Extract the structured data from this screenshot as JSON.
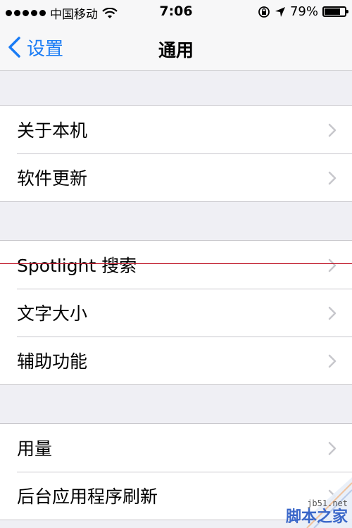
{
  "status_bar": {
    "carrier": "中国移动",
    "time": "7:06",
    "battery_text": "79%",
    "battery_level": 0.79
  },
  "nav": {
    "back_label": "设置",
    "title": "通用"
  },
  "groups": [
    {
      "items": [
        "关于本机",
        "软件更新"
      ]
    },
    {
      "items": [
        "Spotlight 搜索",
        "文字大小",
        "辅助功能"
      ]
    },
    {
      "items": [
        "用量",
        "后台应用程序刷新"
      ]
    }
  ],
  "watermark": {
    "url": "jb51.net",
    "text": "脚本之家"
  },
  "colors": {
    "accent": "#1a7cf5",
    "background": "#efeff4",
    "separator": "#c8c7cc",
    "chevron": "#c7c7cc"
  }
}
